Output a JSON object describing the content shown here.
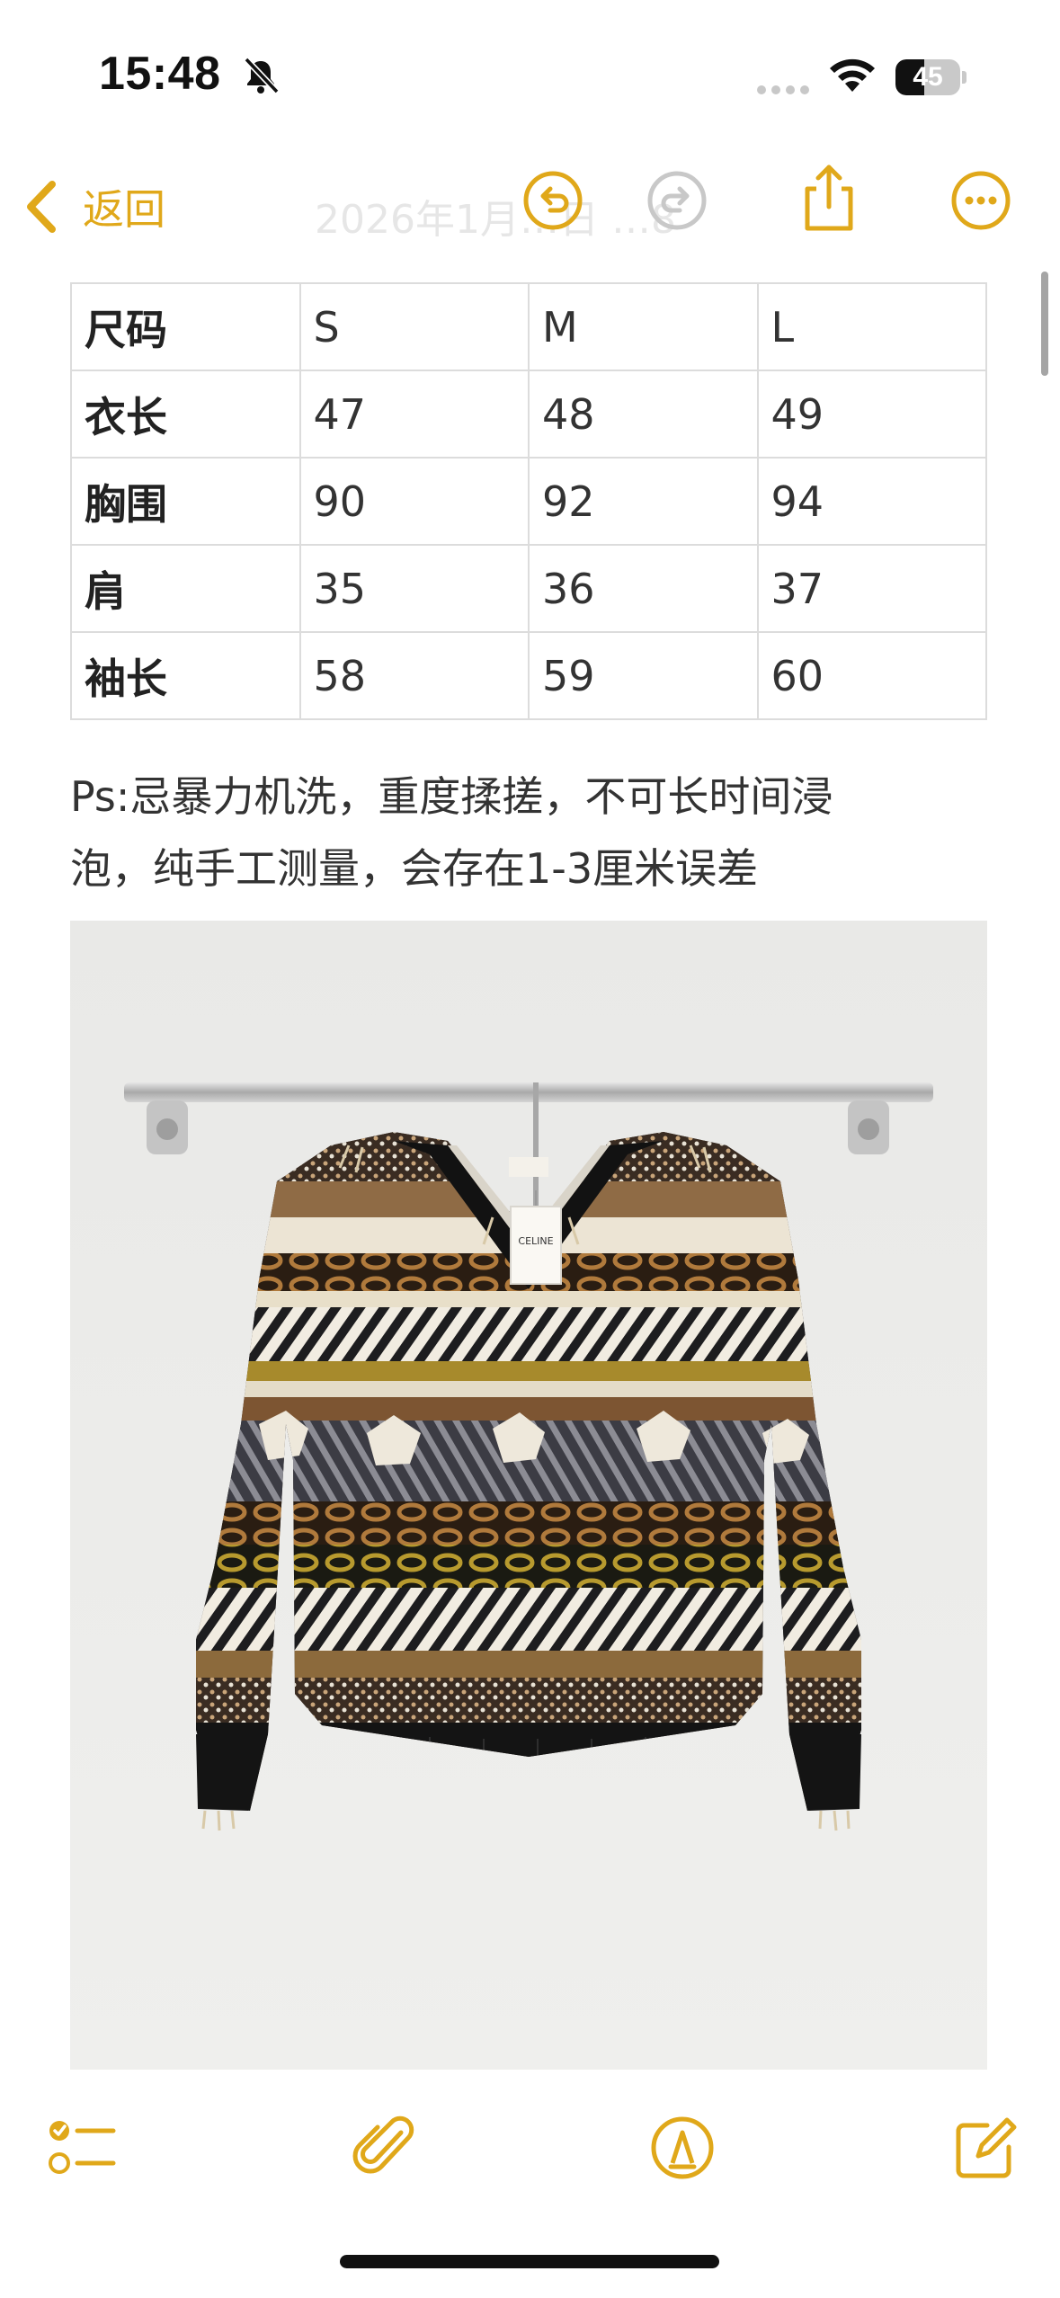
{
  "status_bar": {
    "time": "15:48",
    "battery_level": "45",
    "battery_fraction": 0.45,
    "icons": [
      "bell-slash-icon",
      "signal-icon",
      "wifi-icon",
      "battery-icon"
    ]
  },
  "nav": {
    "back_label": "返回",
    "title": "2026年1月…日 …8",
    "icons": [
      "undo-icon",
      "redo-icon",
      "share-icon",
      "more-icon"
    ],
    "accent_color": "#e0a81a"
  },
  "size_table": {
    "header": [
      "尺码",
      "S",
      "M",
      "L"
    ],
    "rows": [
      [
        "衣长",
        "47",
        "48",
        "49"
      ],
      [
        "胸围",
        "90",
        "92",
        "94"
      ],
      [
        "肩",
        "35",
        "36",
        "37"
      ],
      [
        "袖长",
        "58",
        "59",
        "60"
      ]
    ]
  },
  "note": {
    "line1": "Ps:忌暴力机洗，重度揉搓，不可长时间浸",
    "line2": "泡，纯手工测量，会存在1-3厘米误差"
  },
  "photo": {
    "tag_text": "CELINE"
  },
  "toolbar": {
    "icons": [
      "checklist-icon",
      "attachment-icon",
      "markup-icon",
      "compose-icon"
    ]
  }
}
